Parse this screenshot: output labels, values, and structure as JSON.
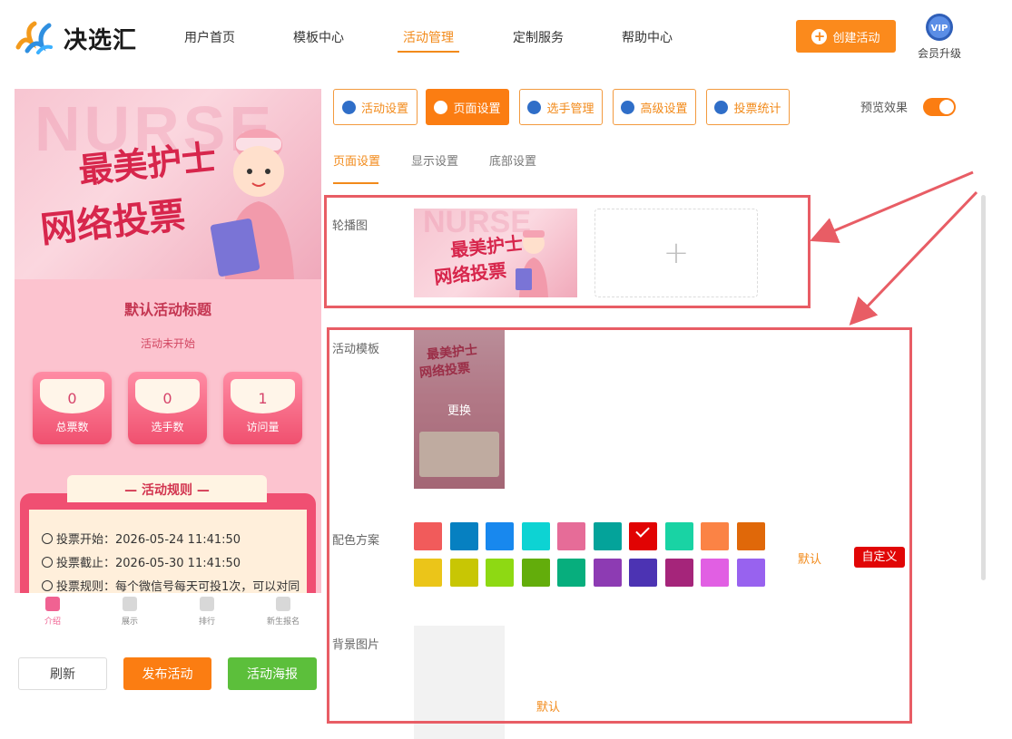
{
  "header": {
    "logo_text": "决选汇",
    "nav": [
      "用户首页",
      "模板中心",
      "活动管理",
      "定制服务",
      "帮助中心"
    ],
    "active_nav": "活动管理",
    "create_button": "创建活动",
    "vip_badge": "VIP",
    "vip_label": "会员升级"
  },
  "preview": {
    "banner_bg_text": "NURSE",
    "banner_title_line1": "最美护士",
    "banner_title_line2": "网络投票",
    "activity_title": "默认活动标题",
    "activity_status": "活动未开始",
    "stats": [
      {
        "value": "0",
        "label": "总票数"
      },
      {
        "value": "0",
        "label": "选手数"
      },
      {
        "value": "1",
        "label": "访问量"
      }
    ],
    "rules_title": "— 活动规则 —",
    "rules": [
      "投票开始：2026-05-24 11:41:50",
      "投票截止：2026-05-30 11:41:50",
      "投票规则：每个微信号每天可投1次，可以对同"
    ],
    "tabbar": [
      "介绍",
      "展示",
      "排行",
      "新生报名"
    ],
    "active_tab": "介绍"
  },
  "bottom_buttons": {
    "refresh": "刷新",
    "publish": "发布活动",
    "poster": "活动海报"
  },
  "toolbar": {
    "buttons": [
      "活动设置",
      "页面设置",
      "选手管理",
      "高级设置",
      "投票统计"
    ],
    "active": "页面设置",
    "preview_label": "预览效果",
    "preview_on": true
  },
  "subtabs": {
    "items": [
      "页面设置",
      "显示设置",
      "底部设置"
    ],
    "active": "页面设置"
  },
  "page_settings": {
    "carousel_label": "轮播图",
    "template_label": "活动模板",
    "template_change": "更换",
    "color_label": "配色方案",
    "colors": [
      "#f15b5b",
      "#0680c1",
      "#1888ee",
      "#0dd3d3",
      "#e66c98",
      "#04a39a",
      "#e10303",
      "#19d3a4",
      "#fb8345",
      "#e06809",
      "#ebc519",
      "#c8c604",
      "#8ed913",
      "#63ad0b",
      "#07ae7d",
      "#8d3bb3",
      "#4c33b3",
      "#a5257a",
      "#e15fe3",
      "#9862ef"
    ],
    "selected_color": "#e10303",
    "default_link": "默认",
    "custom_button": "自定义",
    "bg_label": "背景图片",
    "bg_default": "默认"
  },
  "colors": {
    "accent": "#fb8a1c",
    "highlight_box": "#e85d65"
  }
}
